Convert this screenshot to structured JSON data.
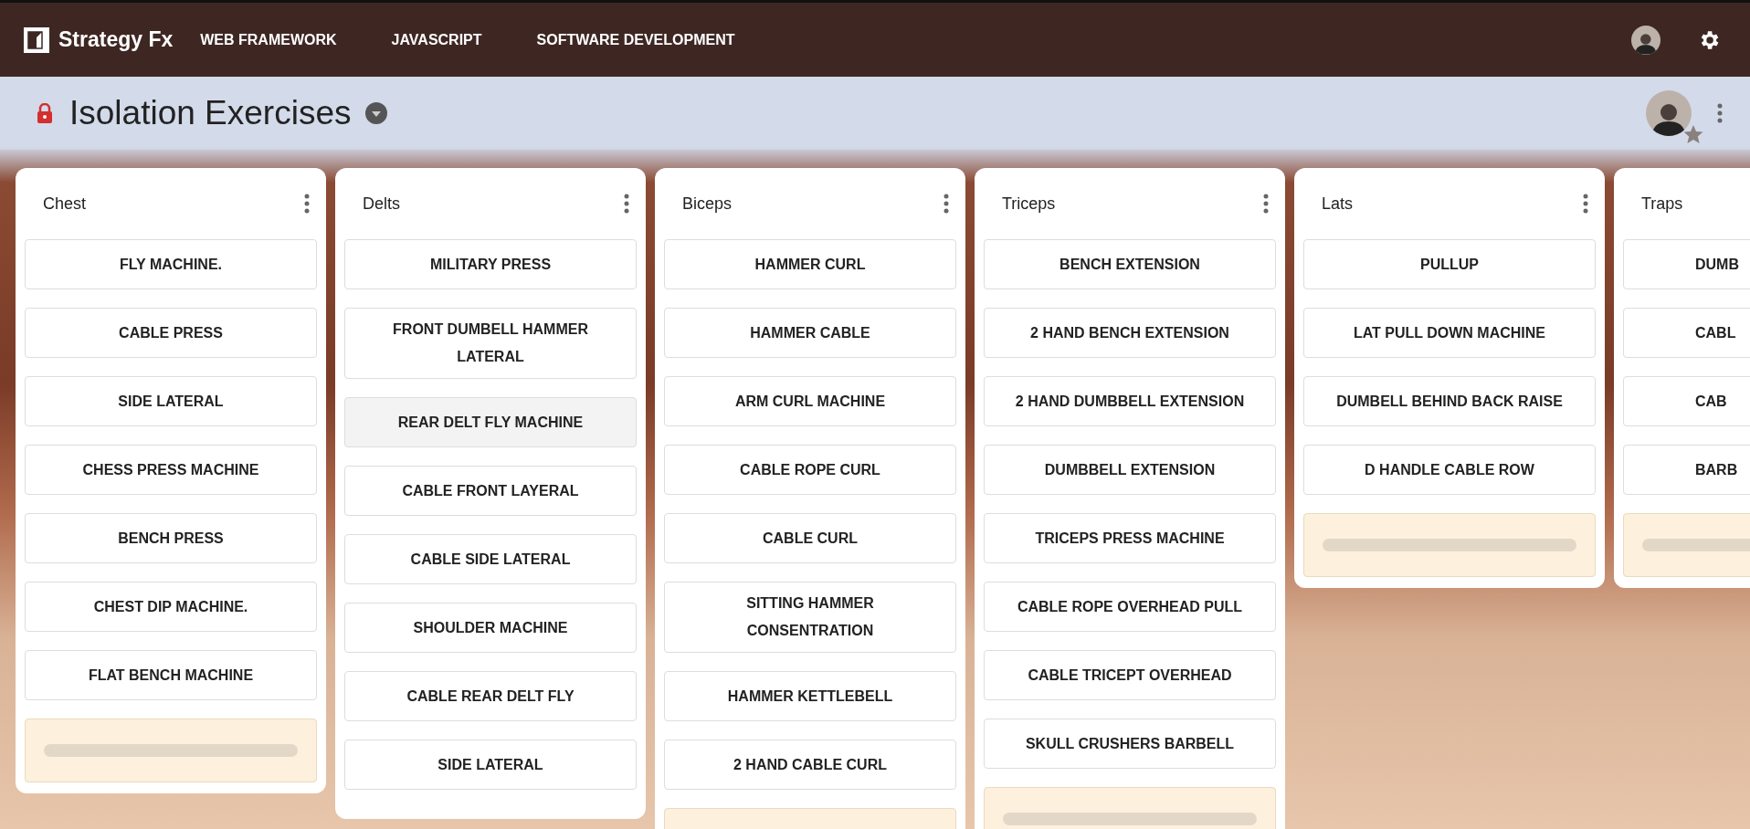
{
  "navbar": {
    "brand": "Strategy Fx",
    "links": [
      {
        "label": "WEB FRAMEWORK"
      },
      {
        "label": "JAVASCRIPT"
      },
      {
        "label": "SOFTWARE DEVELOPMENT"
      }
    ]
  },
  "board": {
    "title": "Isolation Exercises",
    "locked": true,
    "starred": true
  },
  "columns": [
    {
      "title": "Chest",
      "cards": [
        {
          "label": "FLY MACHINE.",
          "highlighted": false
        },
        {
          "label": "CABLE PRESS",
          "highlighted": false
        },
        {
          "label": "SIDE LATERAL",
          "highlighted": false
        },
        {
          "label": "CHESS PRESS MACHINE",
          "highlighted": false
        },
        {
          "label": "BENCH PRESS",
          "highlighted": false
        },
        {
          "label": "CHEST DIP MACHINE.",
          "highlighted": false
        },
        {
          "label": "FLAT BENCH MACHINE",
          "highlighted": false
        }
      ],
      "add_slot": true
    },
    {
      "title": "Delts",
      "cards": [
        {
          "label": "MILITARY PRESS",
          "highlighted": false
        },
        {
          "label": "FRONT DUMBELL HAMMER LATERAL",
          "highlighted": false
        },
        {
          "label": "REAR DELT FLY MACHINE",
          "highlighted": true
        },
        {
          "label": "CABLE FRONT LAYERAL",
          "highlighted": false
        },
        {
          "label": "CABLE SIDE LATERAL",
          "highlighted": false
        },
        {
          "label": "SHOULDER MACHINE",
          "highlighted": false
        },
        {
          "label": "CABLE REAR DELT FLY",
          "highlighted": false
        },
        {
          "label": "SIDE LATERAL",
          "highlighted": false
        }
      ],
      "add_slot": false
    },
    {
      "title": "Biceps",
      "cards": [
        {
          "label": "HAMMER CURL",
          "highlighted": false
        },
        {
          "label": "HAMMER CABLE",
          "highlighted": false
        },
        {
          "label": "ARM CURL MACHINE",
          "highlighted": false
        },
        {
          "label": "CABLE ROPE CURL",
          "highlighted": false
        },
        {
          "label": "CABLE CURL",
          "highlighted": false
        },
        {
          "label": "SITTING HAMMER CONSENTRATION",
          "highlighted": false
        },
        {
          "label": "HAMMER KETTLEBELL",
          "highlighted": false
        },
        {
          "label": "2 HAND CABLE CURL",
          "highlighted": false
        }
      ],
      "add_slot": true
    },
    {
      "title": "Triceps",
      "cards": [
        {
          "label": "BENCH EXTENSION",
          "highlighted": false
        },
        {
          "label": "2 HAND BENCH EXTENSION",
          "highlighted": false
        },
        {
          "label": "2 HAND DUMBBELL EXTENSION",
          "highlighted": false
        },
        {
          "label": "DUMBBELL EXTENSION",
          "highlighted": false
        },
        {
          "label": "TRICEPS PRESS MACHINE",
          "highlighted": false
        },
        {
          "label": "CABLE ROPE OVERHEAD PULL",
          "highlighted": false
        },
        {
          "label": "CABLE TRICEPT OVERHEAD",
          "highlighted": false
        },
        {
          "label": "SKULL CRUSHERS BARBELL",
          "highlighted": false
        }
      ],
      "add_slot": true
    },
    {
      "title": "Lats",
      "cards": [
        {
          "label": "PULLUP",
          "highlighted": false
        },
        {
          "label": "LAT PULL DOWN MACHINE",
          "highlighted": false
        },
        {
          "label": "DUMBELL BEHIND BACK RAISE",
          "highlighted": false
        },
        {
          "label": "D HANDLE CABLE ROW",
          "highlighted": false
        }
      ],
      "add_slot": true
    },
    {
      "title": "Traps",
      "cards": [
        {
          "label": "DUMB",
          "highlighted": false
        },
        {
          "label": "CABL",
          "highlighted": false
        },
        {
          "label": "CAB",
          "highlighted": false
        },
        {
          "label": "BARB",
          "highlighted": false
        }
      ],
      "add_slot": true
    }
  ]
}
